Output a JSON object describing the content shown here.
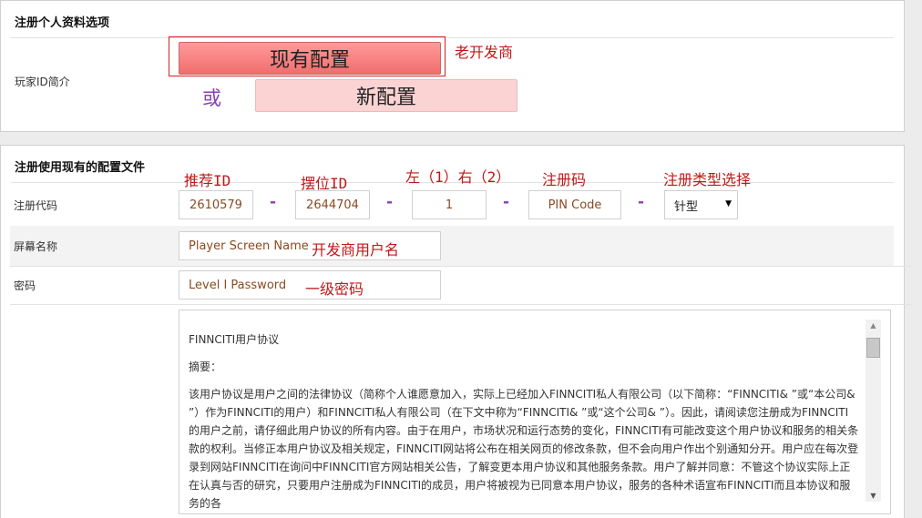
{
  "section1": {
    "title": "注册个人资料选项",
    "field_label": "玩家ID简介",
    "current_config_button": "现有配置",
    "annotation_old_dev": "老开发商",
    "or_text": "或",
    "new_config_button": "新配置"
  },
  "section2": {
    "title": "注册使用现有的配置文件",
    "annotations": {
      "recommend_id": "推荐ID",
      "placement_id": "摆位ID",
      "left_right": "左（1）右（2）",
      "reg_code": "注册码",
      "reg_type": "注册类型选择",
      "dev_username": "开发商用户名",
      "level1_password": "一级密码"
    },
    "reg_code_label": "注册代码",
    "reg_code_fields": {
      "recommend_id_value": "2610579",
      "placement_id_value": "2644704",
      "position_value": "1",
      "pin_placeholder": "PIN Code",
      "separator": "-",
      "type_selected": "针型"
    },
    "screen_name_label": "屏幕名称",
    "screen_name_placeholder": "Player Screen Name",
    "password_label": "密码",
    "password_placeholder": "Level I Password",
    "agreement": {
      "title": "FINNCITI用户协议",
      "summary_heading": "摘要：",
      "body": "该用户协议是用户之间的法律协议（简称个人谁愿意加入，实际上已经加入FINNCITI私人有限公司（以下简称：“FINNCITI& ”或“本公司& ”）作为FINNCITI的用户）和FINNCITI私人有限公司（在下文中称为“FINNCITI& ”或“这个公司& ”）。因此，请阅读您注册成为FINNCITI的用户之前，请仔细此用户协议的所有内容。由于在用户，市场状况和运行态势的变化，FINNCITI有可能改变这个用户协议和服务的相关条款的权利。当修正本用户协议及相关规定，FINNCITI网站将公布在相关网页的修改条款，但不会向用户作出个别通知分开。用户应在每次登录到网站FINNCITI在询问中FINNCITI官方网站相关公告，了解变更本用户协议和其他服务条款。用户了解并同意：不管这个协议实际上正在认真与否的研究，只要用户注册成为FINNCITI的成员，用户将被视为已同意本用户协议，服务的各种术语宣布FINNCITI而且本协议和服务的各"
    }
  }
}
